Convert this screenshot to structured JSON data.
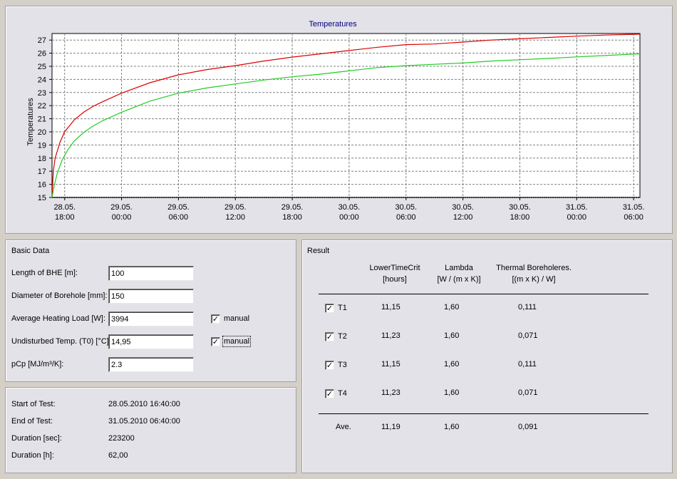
{
  "chart_data": {
    "type": "line",
    "title": "Temperatures",
    "ylabel": "Temperatures",
    "xlabel": "",
    "ylim": [
      15,
      27.5
    ],
    "xlim": [
      16.667,
      78.667
    ],
    "yticks": [
      "15",
      "16",
      "17",
      "18",
      "19",
      "20",
      "21",
      "22",
      "23",
      "24",
      "25",
      "26",
      "27"
    ],
    "xticks": [
      {
        "l1": "28.05.",
        "l2": "18:00"
      },
      {
        "l1": "29.05.",
        "l2": "00:00"
      },
      {
        "l1": "29.05.",
        "l2": "06:00"
      },
      {
        "l1": "29.05.",
        "l2": "12:00"
      },
      {
        "l1": "29.05.",
        "l2": "18:00"
      },
      {
        "l1": "30.05.",
        "l2": "00:00"
      },
      {
        "l1": "30.05.",
        "l2": "06:00"
      },
      {
        "l1": "30.05.",
        "l2": "12:00"
      },
      {
        "l1": "30.05.",
        "l2": "18:00"
      },
      {
        "l1": "31.05.",
        "l2": "00:00"
      },
      {
        "l1": "31.05.",
        "l2": "06:00"
      }
    ],
    "xtick_hours": [
      18,
      24,
      30,
      36,
      42,
      48,
      54,
      60,
      66,
      72,
      78
    ],
    "grid": true,
    "series": [
      {
        "color": "#dd0000",
        "x_hours": [
          16.667,
          16.8,
          17.0,
          17.5,
          18,
          19,
          20,
          21,
          22,
          24,
          27,
          30,
          33,
          36,
          39,
          42,
          45,
          48,
          51,
          54,
          57,
          60,
          63,
          66,
          69,
          72,
          75,
          78.667
        ],
        "values": [
          15.0,
          17.0,
          18.0,
          19.2,
          20.0,
          20.9,
          21.5,
          21.95,
          22.3,
          22.95,
          23.75,
          24.35,
          24.75,
          25.05,
          25.4,
          25.7,
          25.95,
          26.2,
          26.45,
          26.65,
          26.7,
          26.85,
          27.0,
          27.1,
          27.2,
          27.3,
          27.38,
          27.45
        ]
      },
      {
        "color": "#22cc22",
        "x_hours": [
          16.667,
          16.9,
          17.2,
          17.7,
          18.3,
          19,
          20,
          21,
          22,
          24,
          27,
          30,
          33,
          36,
          39,
          42,
          45,
          48,
          51,
          54,
          57,
          60,
          63,
          66,
          69,
          72,
          75,
          78.667
        ],
        "values": [
          15.0,
          15.9,
          16.8,
          17.8,
          18.6,
          19.3,
          19.95,
          20.45,
          20.85,
          21.5,
          22.35,
          22.95,
          23.35,
          23.65,
          23.95,
          24.2,
          24.4,
          24.65,
          24.9,
          25.05,
          25.15,
          25.25,
          25.4,
          25.5,
          25.6,
          25.72,
          25.82,
          25.95
        ]
      }
    ]
  },
  "basic": {
    "title": "Basic Data",
    "length_label": "Length of BHE [m]:",
    "length_value": "100",
    "diameter_label": "Diameter of Borehole [mm]:",
    "diameter_value": "150",
    "load_label": "Average Heating Load [W]:",
    "load_value": "3994",
    "load_manual_label": "manual",
    "load_manual_mark": "✓",
    "temp_label": "Undisturbed Temp. (T0) [°C]:",
    "temp_value": "14,95",
    "temp_manual_label": "manual",
    "temp_manual_mark": "✓",
    "pcp_label": "pCp [MJ/m³/K]:",
    "pcp_value": "2.3"
  },
  "test": {
    "start_label": "Start of Test:",
    "start_value": "28.05.2010 16:40:00",
    "end_label": "End of Test:",
    "end_value": "31.05.2010 06:40:00",
    "dur_sec_label": "Duration [sec]:",
    "dur_sec_value": "223200",
    "dur_h_label": "Duration [h]:",
    "dur_h_value": "62,00"
  },
  "result": {
    "title": "Result",
    "col1_l1": "LowerTimeCrit",
    "col1_l2": "[hours]",
    "col2_l1": "Lambda",
    "col2_l2": "[W / (m x K)]",
    "col3_l1": "Thermal Boreholeres.",
    "col3_l2": "[(m x K) / W]",
    "rows": [
      {
        "name": "T1",
        "mark": "✓",
        "crit": "11,15",
        "lambda": "1,60",
        "res": "0,111"
      },
      {
        "name": "T2",
        "mark": "✓",
        "crit": "11,23",
        "lambda": "1,60",
        "res": "0,071"
      },
      {
        "name": "T3",
        "mark": "✓",
        "crit": "11,15",
        "lambda": "1,60",
        "res": "0,111"
      },
      {
        "name": "T4",
        "mark": "✓",
        "crit": "11,23",
        "lambda": "1,60",
        "res": "0,071"
      }
    ],
    "avg": {
      "name": "Ave.",
      "crit": "11,19",
      "lambda": "1,60",
      "res": "0,091"
    }
  }
}
